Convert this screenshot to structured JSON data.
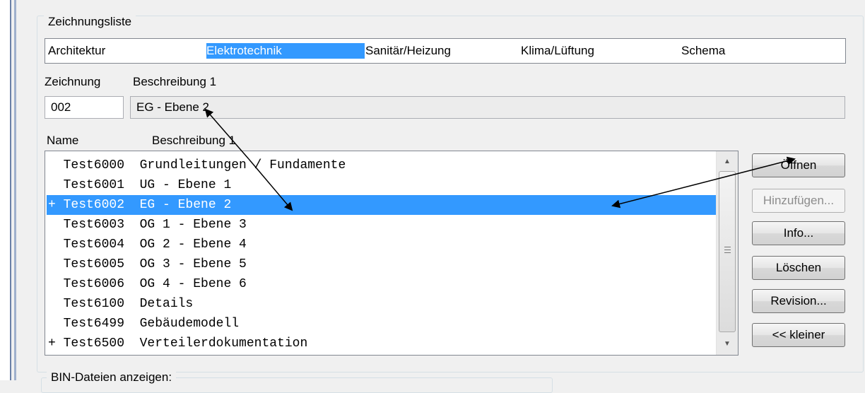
{
  "group": {
    "title": "Zeichnungsliste"
  },
  "categories": [
    {
      "label": "Architektur",
      "selected": false
    },
    {
      "label": "Elektrotechnik",
      "selected": true
    },
    {
      "label": "Sanitär/Heizung",
      "selected": false
    },
    {
      "label": "Klima/Lüftung",
      "selected": false
    },
    {
      "label": "Schema",
      "selected": false
    }
  ],
  "fields": {
    "zeichnung_label": "Zeichnung",
    "beschreibung_label": "Beschreibung 1",
    "zeichnung_value": "002",
    "beschreibung_value": "EG - Ebene 2"
  },
  "list": {
    "col_name": "Name",
    "col_beschreibung": "Beschreibung 1",
    "rows": [
      {
        "text": "  Test6000  Grundleitungen / Fundamente",
        "selected": false
      },
      {
        "text": "  Test6001  UG - Ebene 1",
        "selected": false
      },
      {
        "text": "+ Test6002  EG - Ebene 2",
        "selected": true
      },
      {
        "text": "  Test6003  OG 1 - Ebene 3",
        "selected": false
      },
      {
        "text": "  Test6004  OG 2 - Ebene 4",
        "selected": false
      },
      {
        "text": "  Test6005  OG 3 - Ebene 5",
        "selected": false
      },
      {
        "text": "  Test6006  OG 4 - Ebene 6",
        "selected": false
      },
      {
        "text": "  Test6100  Details",
        "selected": false
      },
      {
        "text": "  Test6499  Gebäudemodell",
        "selected": false
      },
      {
        "text": "+ Test6500  Verteilerdokumentation",
        "selected": false
      }
    ]
  },
  "buttons": {
    "oeffnen": "Öffnen",
    "hinzufuegen": "Hinzufügen...",
    "info": "Info...",
    "loeschen": "Löschen",
    "revision": "Revision...",
    "kleiner": "<< kleiner"
  },
  "group2": {
    "title": "BIN-Dateien anzeigen:"
  },
  "colors": {
    "selection": "#3399ff",
    "annotation_arrow": "#000000"
  }
}
